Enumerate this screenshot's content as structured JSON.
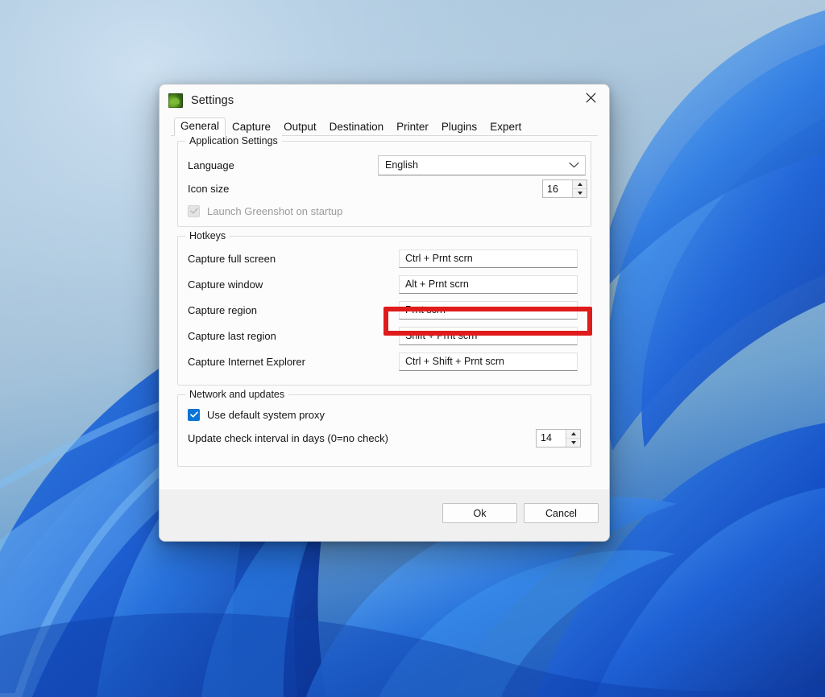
{
  "window": {
    "title": "Settings",
    "app_icon": "greenshot-icon",
    "close_icon": "close-icon"
  },
  "tabs": [
    {
      "label": "General",
      "active": true
    },
    {
      "label": "Capture",
      "active": false
    },
    {
      "label": "Output",
      "active": false
    },
    {
      "label": "Destination",
      "active": false
    },
    {
      "label": "Printer",
      "active": false
    },
    {
      "label": "Plugins",
      "active": false
    },
    {
      "label": "Expert",
      "active": false
    }
  ],
  "application_settings": {
    "legend": "Application Settings",
    "language": {
      "label": "Language",
      "value": "English",
      "chevron_icon": "chevron-down-icon"
    },
    "icon_size": {
      "label": "Icon size",
      "value": "16"
    },
    "launch_on_startup": {
      "label": "Launch Greenshot on startup",
      "checked": true,
      "disabled": true
    }
  },
  "hotkeys": {
    "legend": "Hotkeys",
    "items": [
      {
        "label": "Capture full screen",
        "value": "Ctrl + Prnt scrn",
        "highlighted": false
      },
      {
        "label": "Capture window",
        "value": "Alt + Prnt scrn",
        "highlighted": false
      },
      {
        "label": "Capture region",
        "value": "Prnt scrn",
        "highlighted": true
      },
      {
        "label": "Capture last region",
        "value": "Shift + Prnt scrn",
        "highlighted": false
      },
      {
        "label": "Capture Internet Explorer",
        "value": "Ctrl + Shift + Prnt scrn",
        "highlighted": false
      }
    ]
  },
  "network_and_updates": {
    "legend": "Network and updates",
    "use_default_proxy": {
      "label": "Use default system proxy",
      "checked": true
    },
    "update_interval": {
      "label": "Update check interval in days (0=no check)",
      "value": "14"
    }
  },
  "footer": {
    "ok_label": "Ok",
    "cancel_label": "Cancel"
  },
  "annotation": {
    "color": "#e01b1b",
    "target": "capture-region-hotkey-field"
  },
  "colors": {
    "accent": "#0a73d6",
    "dialog_background": "#fbfbfb",
    "footer_background": "#f0f0f0",
    "wallpaper_light": "#a9c4db",
    "wallpaper_deep": "#1450bd"
  }
}
